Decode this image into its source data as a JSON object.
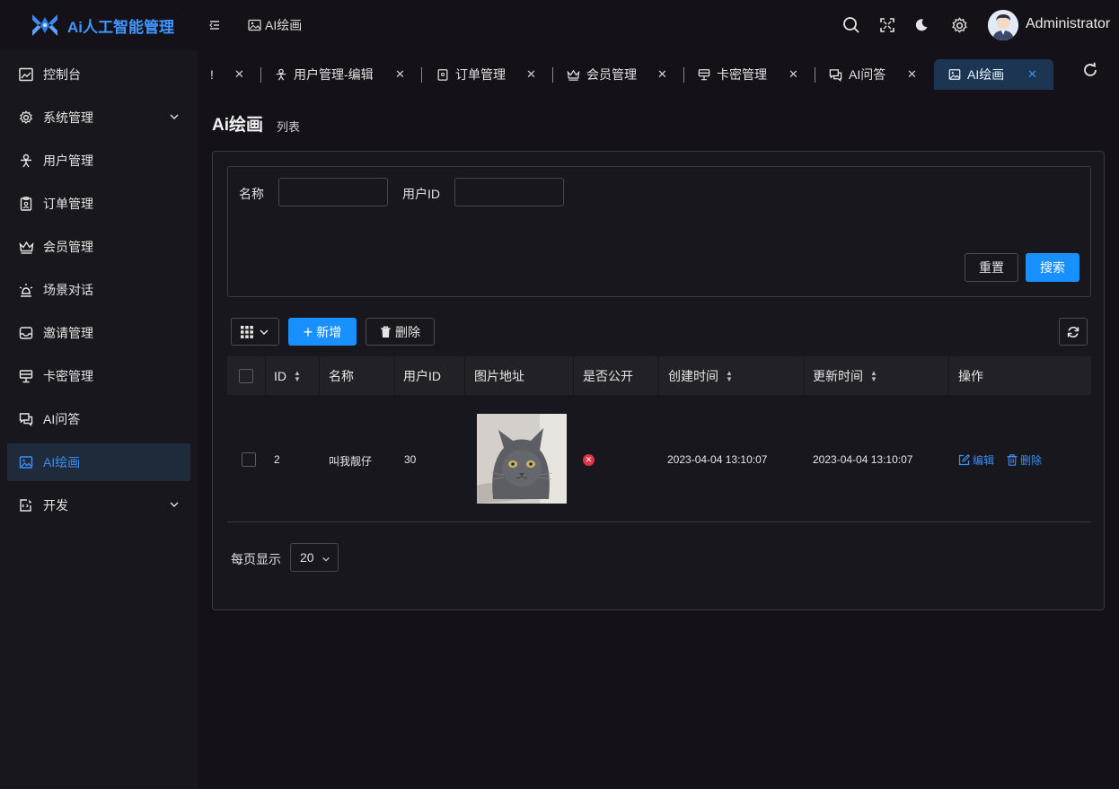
{
  "app": {
    "title": "Ai人工智能管理",
    "username": "Administrator",
    "breadcrumb": "AI绘画"
  },
  "colors": {
    "accent": "#1890ff",
    "active_bg": "#1f2a3a",
    "danger": "#e0334a",
    "background": "#141218"
  },
  "sidebar": {
    "items": [
      {
        "label": "控制台",
        "icon": "dashboard-icon"
      },
      {
        "label": "系统管理",
        "icon": "gear-icon",
        "expandable": true
      },
      {
        "label": "用户管理",
        "icon": "user-icon"
      },
      {
        "label": "订单管理",
        "icon": "order-icon"
      },
      {
        "label": "会员管理",
        "icon": "crown-icon"
      },
      {
        "label": "场景对话",
        "icon": "scene-icon"
      },
      {
        "label": "邀请管理",
        "icon": "inbox-icon"
      },
      {
        "label": "卡密管理",
        "icon": "card-icon"
      },
      {
        "label": "AI问答",
        "icon": "chat-icon"
      },
      {
        "label": "AI绘画",
        "icon": "image-icon",
        "active": true
      },
      {
        "label": "开发",
        "icon": "dev-icon",
        "expandable": true
      }
    ]
  },
  "tabs": [
    {
      "label": "!"
    },
    {
      "label": "用户管理-编辑"
    },
    {
      "label": "订单管理"
    },
    {
      "label": "会员管理"
    },
    {
      "label": "卡密管理"
    },
    {
      "label": "AI问答"
    },
    {
      "label": "AI绘画",
      "active": true
    }
  ],
  "page": {
    "title": "Ai绘画",
    "subtitle": "列表"
  },
  "search": {
    "name_label": "名称",
    "name_value": "",
    "userid_label": "用户ID",
    "userid_value": "",
    "reset_label": "重置",
    "search_label": "搜索"
  },
  "toolbar": {
    "add_label": "新增",
    "delete_label": "删除"
  },
  "table": {
    "columns": [
      "ID",
      "名称",
      "用户ID",
      "图片地址",
      "是否公开",
      "创建时间",
      "更新时间",
      "操作"
    ],
    "rows": [
      {
        "id": "2",
        "name": "叫我靓仔",
        "user_id": "30",
        "image": "cat-photo",
        "public": false,
        "created": "2023-04-04 13:10:07",
        "updated": "2023-04-04 13:10:07",
        "edit_label": "编辑",
        "delete_label": "删除"
      }
    ]
  },
  "pagination": {
    "per_page_label": "每页显示",
    "per_page_value": "20"
  }
}
